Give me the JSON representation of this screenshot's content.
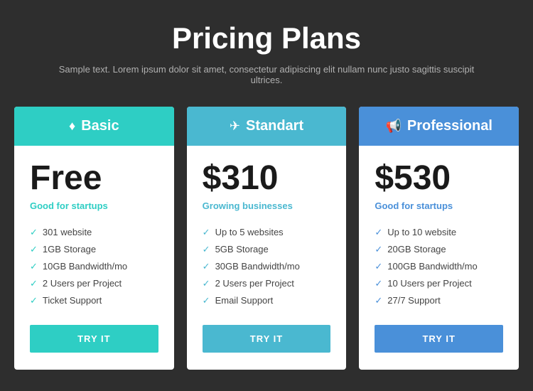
{
  "header": {
    "title": "Pricing Plans",
    "subtitle": "Sample text. Lorem ipsum dolor sit amet, consectetur adipiscing elit nullam nunc justo sagittis suscipit ultrices."
  },
  "plans": [
    {
      "id": "basic",
      "icon": "♦",
      "name": "Basic",
      "price": "Free",
      "tagline": "Good for startups",
      "colorClass": "basic",
      "features": [
        "301 website",
        "1GB Storage",
        "10GB Bandwidth/mo",
        "2 Users per Project",
        "Ticket Support"
      ],
      "button_label": "TRY IT"
    },
    {
      "id": "standart",
      "icon": "✈",
      "name": "Standart",
      "price": "$310",
      "tagline": "Growing businesses",
      "colorClass": "standart",
      "features": [
        "Up to 5 websites",
        "5GB Storage",
        "30GB Bandwidth/mo",
        "2 Users per Project",
        "Email Support"
      ],
      "button_label": "TRY IT"
    },
    {
      "id": "professional",
      "icon": "📣",
      "name": "Professional",
      "price": "$530",
      "tagline": "Good for startups",
      "colorClass": "professional",
      "features": [
        "Up to 10 website",
        "20GB Storage",
        "100GB Bandwidth/mo",
        "10 Users per Project",
        "27/7 Support"
      ],
      "button_label": "TRY IT"
    }
  ]
}
